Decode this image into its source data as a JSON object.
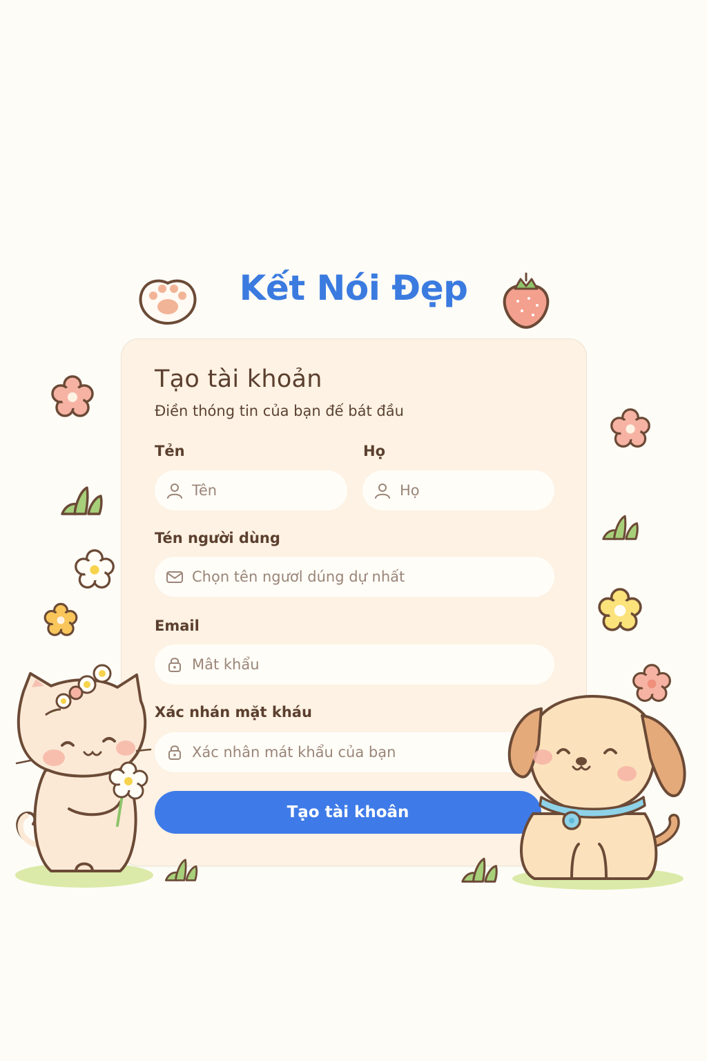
{
  "brand": {
    "title": "Kết Nói Đẹp"
  },
  "form": {
    "title": "Tạo tài khoản",
    "subtitle": "Điền thóng tin của bạn đế bát đầu",
    "first_name": {
      "label": "Tẻn",
      "placeholder": "Tên",
      "icon": "user-icon"
    },
    "last_name": {
      "label": "Họ",
      "placeholder": "Họ",
      "icon": "user-icon"
    },
    "username": {
      "label": "Tén người dùng",
      "placeholder": "Chọn tên ngươl dúng dự nhất",
      "icon": "mail-icon"
    },
    "email": {
      "label": "Email",
      "placeholder": "Mât khẩu",
      "icon": "lock-icon"
    },
    "confirm_password": {
      "label": "Xác nhán mặt kháu",
      "placeholder": "Xác nhân mát khẩu của bạn",
      "icon": "lock-icon"
    },
    "submit_label": "Tạo tài khoân"
  },
  "colors": {
    "accent": "#3f7be8",
    "brand": "#3b7be0",
    "card": "#fdf2e3",
    "background": "#fdfcf7",
    "text": "#5b3f2e"
  }
}
